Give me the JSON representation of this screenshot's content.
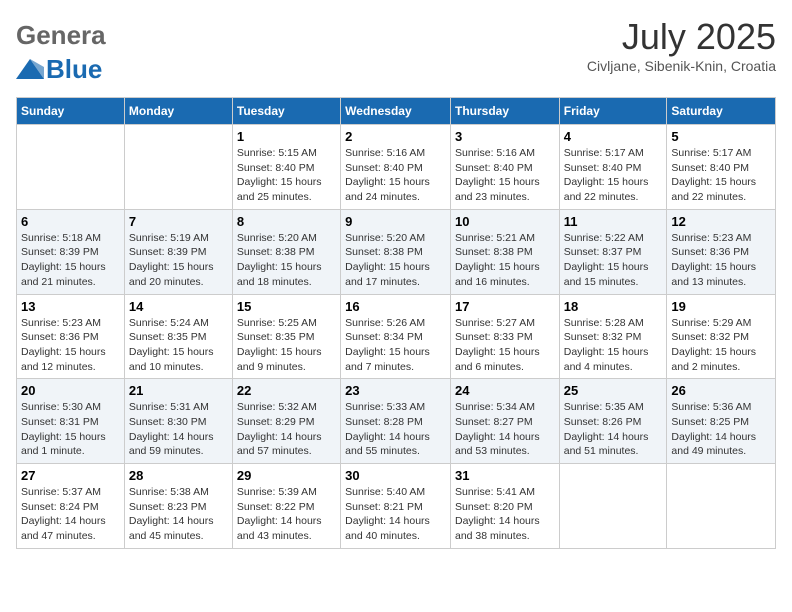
{
  "header": {
    "logo": {
      "general": "General",
      "blue": "Blue"
    },
    "title": "July 2025",
    "location": "Civljane, Sibenik-Knin, Croatia"
  },
  "weekdays": [
    "Sunday",
    "Monday",
    "Tuesday",
    "Wednesday",
    "Thursday",
    "Friday",
    "Saturday"
  ],
  "weeks": [
    [
      {
        "day": "",
        "info": ""
      },
      {
        "day": "",
        "info": ""
      },
      {
        "day": "1",
        "info": "Sunrise: 5:15 AM\nSunset: 8:40 PM\nDaylight: 15 hours\nand 25 minutes."
      },
      {
        "day": "2",
        "info": "Sunrise: 5:16 AM\nSunset: 8:40 PM\nDaylight: 15 hours\nand 24 minutes."
      },
      {
        "day": "3",
        "info": "Sunrise: 5:16 AM\nSunset: 8:40 PM\nDaylight: 15 hours\nand 23 minutes."
      },
      {
        "day": "4",
        "info": "Sunrise: 5:17 AM\nSunset: 8:40 PM\nDaylight: 15 hours\nand 22 minutes."
      },
      {
        "day": "5",
        "info": "Sunrise: 5:17 AM\nSunset: 8:40 PM\nDaylight: 15 hours\nand 22 minutes."
      }
    ],
    [
      {
        "day": "6",
        "info": "Sunrise: 5:18 AM\nSunset: 8:39 PM\nDaylight: 15 hours\nand 21 minutes."
      },
      {
        "day": "7",
        "info": "Sunrise: 5:19 AM\nSunset: 8:39 PM\nDaylight: 15 hours\nand 20 minutes."
      },
      {
        "day": "8",
        "info": "Sunrise: 5:20 AM\nSunset: 8:38 PM\nDaylight: 15 hours\nand 18 minutes."
      },
      {
        "day": "9",
        "info": "Sunrise: 5:20 AM\nSunset: 8:38 PM\nDaylight: 15 hours\nand 17 minutes."
      },
      {
        "day": "10",
        "info": "Sunrise: 5:21 AM\nSunset: 8:38 PM\nDaylight: 15 hours\nand 16 minutes."
      },
      {
        "day": "11",
        "info": "Sunrise: 5:22 AM\nSunset: 8:37 PM\nDaylight: 15 hours\nand 15 minutes."
      },
      {
        "day": "12",
        "info": "Sunrise: 5:23 AM\nSunset: 8:36 PM\nDaylight: 15 hours\nand 13 minutes."
      }
    ],
    [
      {
        "day": "13",
        "info": "Sunrise: 5:23 AM\nSunset: 8:36 PM\nDaylight: 15 hours\nand 12 minutes."
      },
      {
        "day": "14",
        "info": "Sunrise: 5:24 AM\nSunset: 8:35 PM\nDaylight: 15 hours\nand 10 minutes."
      },
      {
        "day": "15",
        "info": "Sunrise: 5:25 AM\nSunset: 8:35 PM\nDaylight: 15 hours\nand 9 minutes."
      },
      {
        "day": "16",
        "info": "Sunrise: 5:26 AM\nSunset: 8:34 PM\nDaylight: 15 hours\nand 7 minutes."
      },
      {
        "day": "17",
        "info": "Sunrise: 5:27 AM\nSunset: 8:33 PM\nDaylight: 15 hours\nand 6 minutes."
      },
      {
        "day": "18",
        "info": "Sunrise: 5:28 AM\nSunset: 8:32 PM\nDaylight: 15 hours\nand 4 minutes."
      },
      {
        "day": "19",
        "info": "Sunrise: 5:29 AM\nSunset: 8:32 PM\nDaylight: 15 hours\nand 2 minutes."
      }
    ],
    [
      {
        "day": "20",
        "info": "Sunrise: 5:30 AM\nSunset: 8:31 PM\nDaylight: 15 hours\nand 1 minute."
      },
      {
        "day": "21",
        "info": "Sunrise: 5:31 AM\nSunset: 8:30 PM\nDaylight: 14 hours\nand 59 minutes."
      },
      {
        "day": "22",
        "info": "Sunrise: 5:32 AM\nSunset: 8:29 PM\nDaylight: 14 hours\nand 57 minutes."
      },
      {
        "day": "23",
        "info": "Sunrise: 5:33 AM\nSunset: 8:28 PM\nDaylight: 14 hours\nand 55 minutes."
      },
      {
        "day": "24",
        "info": "Sunrise: 5:34 AM\nSunset: 8:27 PM\nDaylight: 14 hours\nand 53 minutes."
      },
      {
        "day": "25",
        "info": "Sunrise: 5:35 AM\nSunset: 8:26 PM\nDaylight: 14 hours\nand 51 minutes."
      },
      {
        "day": "26",
        "info": "Sunrise: 5:36 AM\nSunset: 8:25 PM\nDaylight: 14 hours\nand 49 minutes."
      }
    ],
    [
      {
        "day": "27",
        "info": "Sunrise: 5:37 AM\nSunset: 8:24 PM\nDaylight: 14 hours\nand 47 minutes."
      },
      {
        "day": "28",
        "info": "Sunrise: 5:38 AM\nSunset: 8:23 PM\nDaylight: 14 hours\nand 45 minutes."
      },
      {
        "day": "29",
        "info": "Sunrise: 5:39 AM\nSunset: 8:22 PM\nDaylight: 14 hours\nand 43 minutes."
      },
      {
        "day": "30",
        "info": "Sunrise: 5:40 AM\nSunset: 8:21 PM\nDaylight: 14 hours\nand 40 minutes."
      },
      {
        "day": "31",
        "info": "Sunrise: 5:41 AM\nSunset: 8:20 PM\nDaylight: 14 hours\nand 38 minutes."
      },
      {
        "day": "",
        "info": ""
      },
      {
        "day": "",
        "info": ""
      }
    ]
  ]
}
